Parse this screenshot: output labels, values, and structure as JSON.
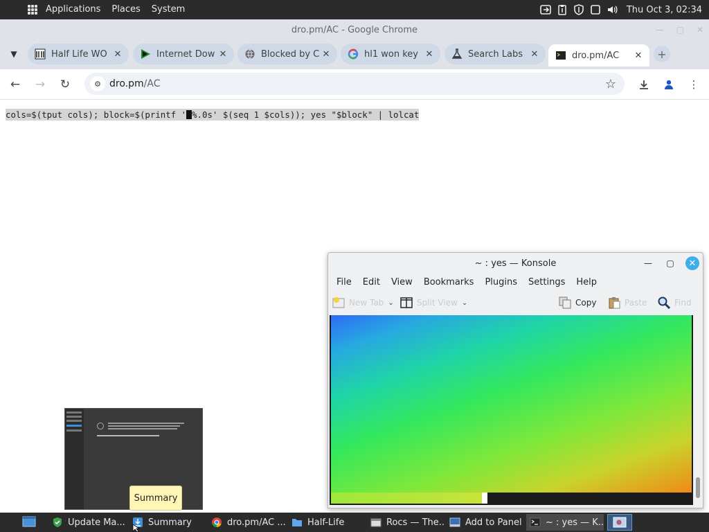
{
  "top_panel": {
    "menus": [
      "Applications",
      "Places",
      "System"
    ],
    "clock": "Thu Oct  3, 02:34"
  },
  "browser": {
    "window_title": "dro.pm/AC - Google Chrome",
    "tabs": [
      {
        "label": "Half Life WO",
        "icon": "wikipedia-icon",
        "active": false
      },
      {
        "label": "Internet Dow",
        "icon": "play-triangle-icon",
        "active": false
      },
      {
        "label": "Blocked by C",
        "icon": "globe-icon",
        "active": false
      },
      {
        "label": "hl1 won key",
        "icon": "google-icon",
        "active": false
      },
      {
        "label": "Search Labs",
        "icon": "labs-flask-icon",
        "active": false
      },
      {
        "label": "dro.pm/AC",
        "icon": "terminal-favicon-icon",
        "active": true
      }
    ],
    "url_host": "dro.pm",
    "url_path": "/AC",
    "page": {
      "command_before_cursor": "cols=$(tput cols); block=$(printf '",
      "command_after_cursor": "%.0s' $(seq 1 $cols)); yes \"$block\" | lolcat"
    }
  },
  "konsole": {
    "title": "~ : yes — Konsole",
    "menus": [
      "File",
      "Edit",
      "View",
      "Bookmarks",
      "Plugins",
      "Settings",
      "Help"
    ],
    "toolbar": {
      "new_tab": "New Tab",
      "split_view": "Split View",
      "copy": "Copy",
      "paste": "Paste",
      "find": "Find"
    }
  },
  "preview": {
    "tooltip": "Summary"
  },
  "taskbar": {
    "tasks": [
      {
        "label": "Update Ma...",
        "icon": "shield-icon"
      },
      {
        "label": "Summary",
        "icon": "download-icon"
      },
      {
        "label": "dro.pm/AC ...",
        "icon": "chrome-icon"
      },
      {
        "label": "Half-Life",
        "icon": "folder-icon"
      },
      {
        "label": "Rocs — The...",
        "icon": "window-icon"
      },
      {
        "label": "Add to Panel",
        "icon": "panel-icon"
      },
      {
        "label": "~ : yes — K...",
        "icon": "konsole-icon"
      }
    ]
  },
  "colors": {
    "panel_bg": "#2b2b2b",
    "chrome_frame": "#dfe3e9",
    "konsole_close": "#3daee9"
  }
}
